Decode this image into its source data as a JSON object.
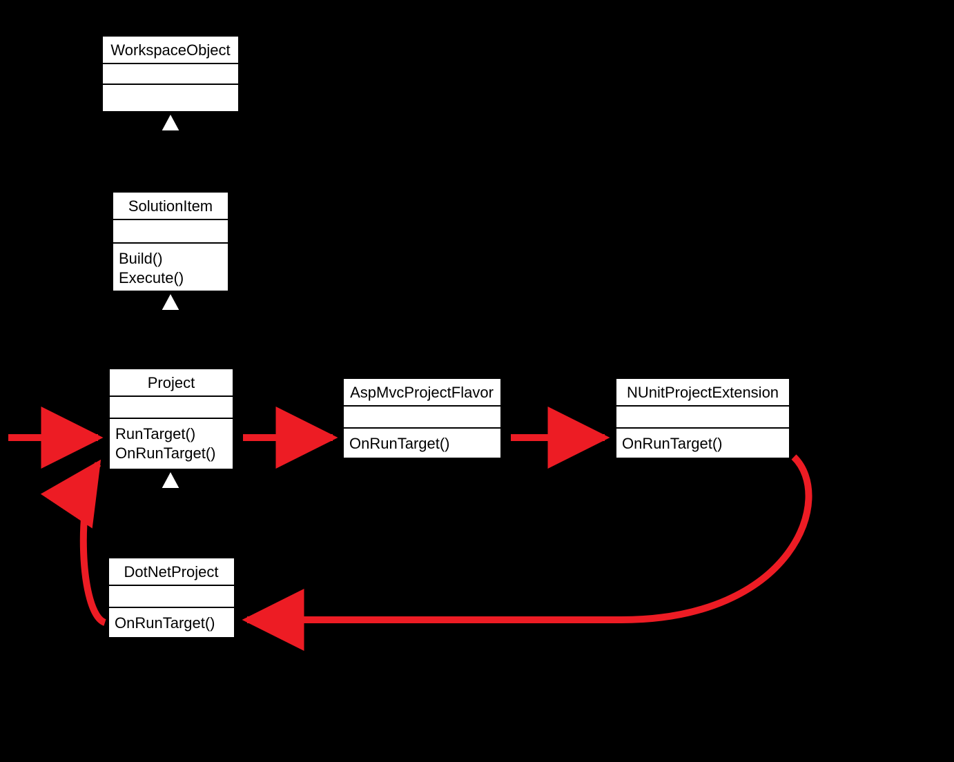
{
  "classes": {
    "workspaceObject": {
      "name": "WorkspaceObject"
    },
    "solutionItem": {
      "name": "SolutionItem",
      "methods": {
        "build": "Build()",
        "execute": "Execute()"
      }
    },
    "project": {
      "name": "Project",
      "methods": {
        "runTarget": "RunTarget()",
        "onRunTarget": "OnRunTarget()"
      }
    },
    "aspMvcProjectFlavor": {
      "name": "AspMvcProjectFlavor",
      "methods": {
        "onRunTarget": "OnRunTarget()"
      }
    },
    "nUnitProjectExtension": {
      "name": "NUnitProjectExtension",
      "methods": {
        "onRunTarget": "OnRunTarget()"
      }
    },
    "dotNetProject": {
      "name": "DotNetProject",
      "methods": {
        "onRunTarget": "OnRunTarget()"
      }
    }
  },
  "flow_arrows": [
    {
      "from": "entry",
      "to": "project.RunTarget"
    },
    {
      "from": "project.RunTarget",
      "to": "aspMvcProjectFlavor.OnRunTarget"
    },
    {
      "from": "aspMvcProjectFlavor.OnRunTarget",
      "to": "nUnitProjectExtension.OnRunTarget"
    },
    {
      "from": "nUnitProjectExtension.OnRunTarget",
      "to": "dotNetProject.OnRunTarget"
    },
    {
      "from": "dotNetProject.OnRunTarget",
      "to": "project.OnRunTarget"
    }
  ],
  "inheritance": [
    {
      "child": "SolutionItem",
      "parent": "WorkspaceObject"
    },
    {
      "child": "Project",
      "parent": "SolutionItem"
    },
    {
      "child": "DotNetProject",
      "parent": "Project"
    }
  ],
  "colors": {
    "arrow": "#ed1c24",
    "box_fill": "#ffffff",
    "box_stroke": "#000000",
    "bg": "#000000"
  }
}
